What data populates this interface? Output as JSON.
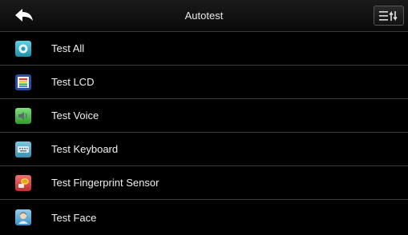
{
  "header": {
    "title": "Autotest"
  },
  "items": [
    {
      "label": "Test All",
      "icon": "test-all-icon"
    },
    {
      "label": "Test LCD",
      "icon": "lcd-icon"
    },
    {
      "label": "Test Voice",
      "icon": "voice-icon"
    },
    {
      "label": "Test Keyboard",
      "icon": "keyboard-icon"
    },
    {
      "label": "Test Fingerprint Sensor",
      "icon": "fingerprint-icon"
    },
    {
      "label": "Test Face",
      "icon": "face-icon"
    }
  ],
  "colors": {
    "background": "#000000",
    "divider": "#3a3a3a",
    "text": "#f0f0f0"
  }
}
